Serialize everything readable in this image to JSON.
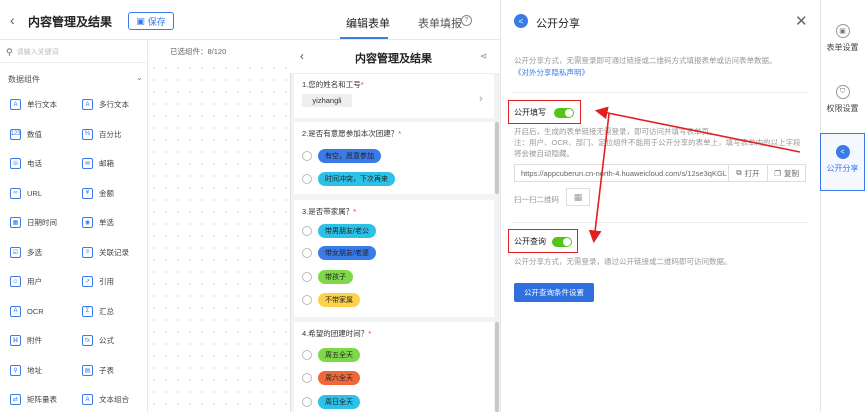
{
  "header": {
    "back_icon": "back-arrow-icon",
    "title": "内容管理及结果",
    "save_label": "保存",
    "tabs": [
      {
        "label": "编辑表单",
        "active": true
      },
      {
        "label": "表单填报",
        "active": false
      }
    ],
    "help_icon": "question-icon"
  },
  "palette": {
    "search_placeholder": "请输入关键词",
    "selected_count": "已选组件：8/120",
    "group_label": "数据组件",
    "components": [
      {
        "icon": "single-line-text-icon",
        "glyph": "A",
        "label": "单行文本"
      },
      {
        "icon": "multi-line-text-icon",
        "glyph": "A",
        "label": "多行文本"
      },
      {
        "icon": "number-icon",
        "glyph": "123",
        "label": "数值"
      },
      {
        "icon": "percent-icon",
        "glyph": "%",
        "label": "百分比"
      },
      {
        "icon": "phone-icon",
        "glyph": "☏",
        "label": "电话"
      },
      {
        "icon": "email-icon",
        "glyph": "✉",
        "label": "邮箱"
      },
      {
        "icon": "url-icon",
        "glyph": "∞",
        "label": "URL"
      },
      {
        "icon": "amount-icon",
        "glyph": "¥",
        "label": "金额"
      },
      {
        "icon": "datetime-icon",
        "glyph": "▦",
        "label": "日期时间"
      },
      {
        "icon": "single-select-icon",
        "glyph": "◉",
        "label": "单选"
      },
      {
        "icon": "multi-select-icon",
        "glyph": "☑",
        "label": "多选"
      },
      {
        "icon": "relation-icon",
        "glyph": "≡",
        "label": "关联记录"
      },
      {
        "icon": "user-icon",
        "glyph": "☺",
        "label": "用户"
      },
      {
        "icon": "reference-icon",
        "glyph": "↗",
        "label": "引用"
      },
      {
        "icon": "ocr-icon",
        "glyph": "A",
        "label": "OCR"
      },
      {
        "icon": "summary-icon",
        "glyph": "Σ",
        "label": "汇总"
      },
      {
        "icon": "attachment-icon",
        "glyph": "⌘",
        "label": "附件"
      },
      {
        "icon": "formula-icon",
        "glyph": "fx",
        "label": "公式"
      },
      {
        "icon": "address-icon",
        "glyph": "⚲",
        "label": "地址"
      },
      {
        "icon": "subtable-icon",
        "glyph": "▤",
        "label": "子表"
      },
      {
        "icon": "cross-table-icon",
        "glyph": "⇄",
        "label": "矩阵量表"
      },
      {
        "icon": "text-combine-icon",
        "glyph": "A",
        "label": "文本组合"
      }
    ]
  },
  "preview": {
    "title": "内容管理及结果",
    "questions": [
      {
        "label": "1.您的姓名和工号",
        "required": true,
        "answer": "yizhangli"
      },
      {
        "label": "2.是否有意愿参加本次团建？",
        "required": true,
        "options": [
          {
            "label": "有空，愿意参加",
            "color": "#3b7be8"
          },
          {
            "label": "时间冲突，下次再来",
            "color": "#2cc2e8"
          }
        ]
      },
      {
        "label": "3.是否带家属？",
        "required": true,
        "options": [
          {
            "label": "带男朋友/老公",
            "color": "#2cc2e8"
          },
          {
            "label": "带女朋友/老婆",
            "color": "#3b7be8"
          },
          {
            "label": "带孩子",
            "color": "#7fd84a"
          },
          {
            "label": "不带家属",
            "color": "#fbd24a"
          }
        ]
      },
      {
        "label": "4.希望的团建时间？",
        "required": true,
        "options": [
          {
            "label": "周五全天",
            "color": "#7fd84a"
          },
          {
            "label": "周六全天",
            "color": "#f0683a"
          },
          {
            "label": "周日全天",
            "color": "#2cc2e8"
          }
        ]
      }
    ]
  },
  "share_panel": {
    "title": "公开分享",
    "description": "公开分享方式，无需登录即可通过链接或二维码方式填报表单或访问表单数据。",
    "privacy_link": "《对外分享隐私声明》",
    "public_fill": {
      "label": "公开填写",
      "enabled": true,
      "hint_1": "开启后，生成的表单链接无需登录，即可访问并填写表单页。",
      "hint_2": "注：用户、OCR、部门、定位组件不能用于公开分享的表单上，填写表单内的以上字段将会被自动隐藏。",
      "url": "https://appcuberun.cn-north-4.huaweicloud.com/s/12se3qKGL",
      "open_label": "打开",
      "copy_label": "复制",
      "qr_label": "扫一扫二维码"
    },
    "public_query": {
      "label": "公开查询",
      "enabled": true,
      "hint": "公开分享方式，无需登录，通过公开链接或二维码即可访问数据。",
      "button_label": "公开查询条件设置"
    }
  },
  "rail": [
    {
      "label": "表单设置",
      "icon": "form-settings-icon",
      "glyph": "▣",
      "active": false
    },
    {
      "label": "权限设置",
      "icon": "permission-icon",
      "glyph": "⛉",
      "active": false
    },
    {
      "label": "公开分享",
      "icon": "share-icon",
      "glyph": "<",
      "active": true
    }
  ],
  "colors": {
    "accent": "#3b7be8",
    "toggle_on": "#52c41a",
    "annotation_red": "#e02020"
  }
}
